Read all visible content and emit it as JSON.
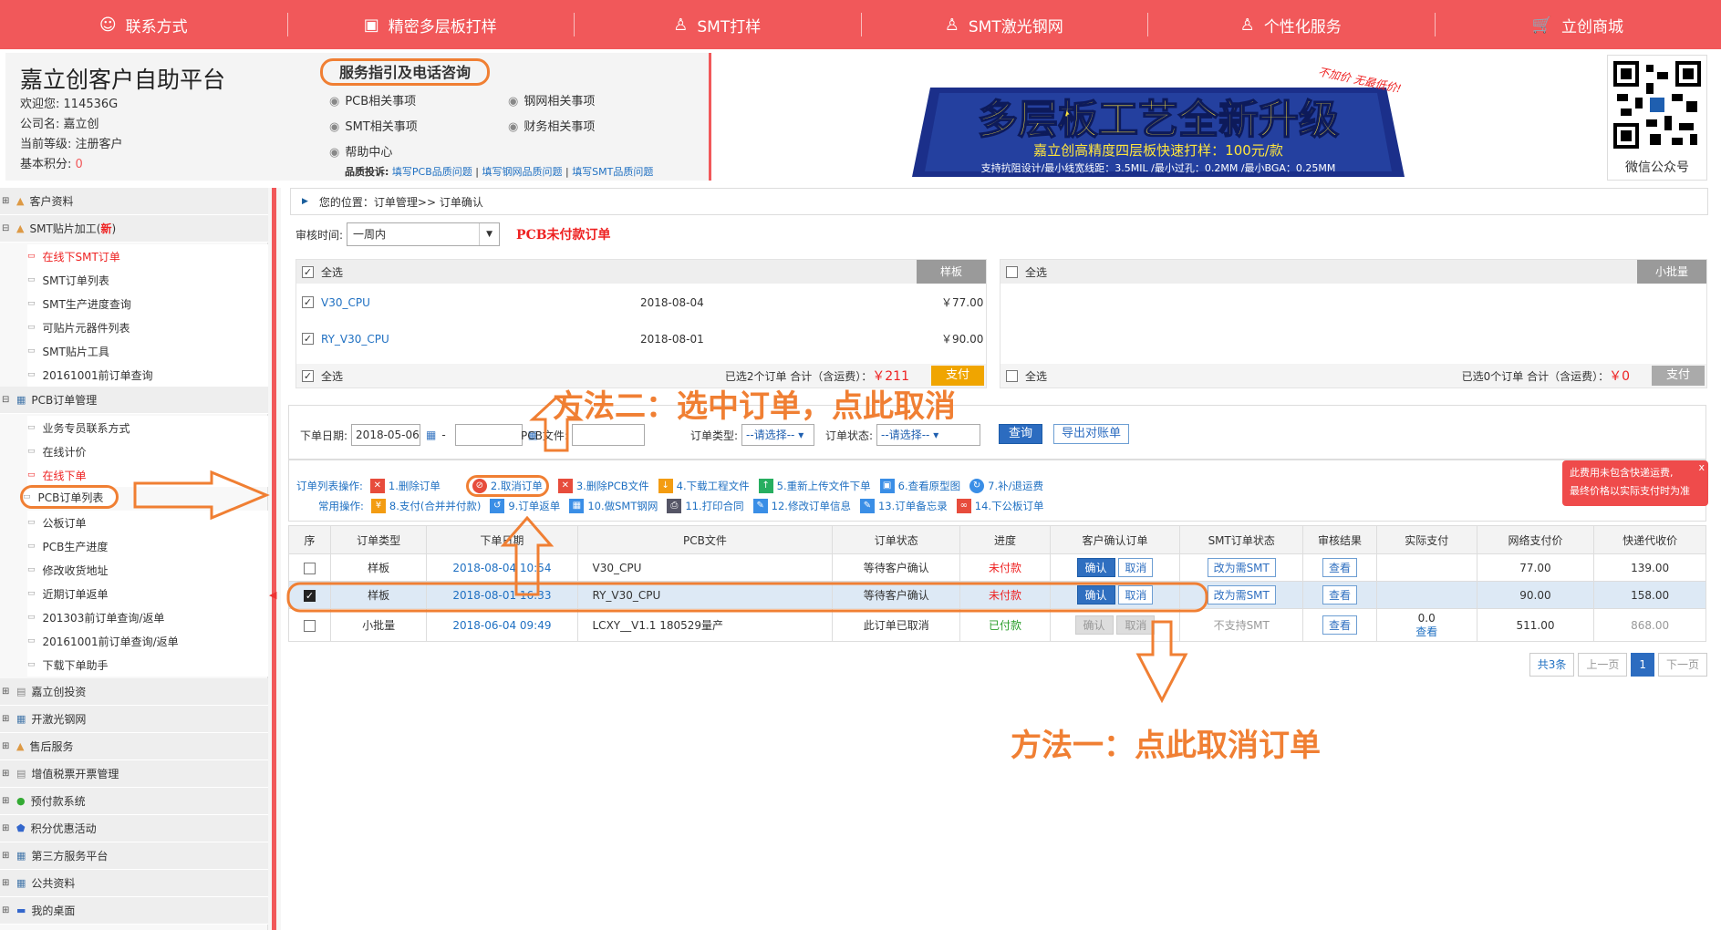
{
  "topnav": [
    {
      "icon": "person-icon",
      "glyph": "☺",
      "label": "联系方式"
    },
    {
      "icon": "chip-icon",
      "glyph": "▣",
      "label": "精密多层板打样"
    },
    {
      "icon": "person-icon",
      "glyph": "♙",
      "label": "SMT打样"
    },
    {
      "icon": "person-icon",
      "glyph": "♙",
      "label": "SMT激光钢网"
    },
    {
      "icon": "person-icon",
      "glyph": "♙",
      "label": "个性化服务"
    },
    {
      "icon": "cart-icon",
      "glyph": "🛒",
      "label": "立创商城"
    }
  ],
  "header": {
    "platform_title": "嘉立创客户自助平台",
    "welcome_label": "欢迎您:",
    "welcome_value": "114536G",
    "company_label": "公司名:",
    "company_value": "嘉立创",
    "level_label": "当前等级:",
    "level_value": "注册客户",
    "points_label": "基本积分:",
    "points_value": "0",
    "service_title": "服务指引及电话咨询",
    "links": [
      "PCB相关事项",
      "钢网相关事项",
      "SMT相关事项",
      "财务相关事项",
      "帮助中心"
    ],
    "quality_label": "品质投诉:",
    "quality_links": [
      "填写PCB品质问题",
      "填写钢网品质问题",
      "填写SMT品质问题"
    ],
    "banner_title": "多层板工艺全新升级",
    "banner_sub": "嘉立创高精度四层板快速打样：100元/款",
    "banner_note": "支持抗阻设计/最小线宽线距：3.5MIL  /最小过孔：0.2MM  /最小BGA：0.25MM",
    "banner_slogan": "不加价 无最低价!",
    "qr_label": "微信公众号"
  },
  "sidebar": {
    "groups": [
      {
        "label": "客户资料",
        "icon": "user-icon",
        "pm": "⊞"
      },
      {
        "label": "SMT贴片加工(",
        "badge": "新",
        "suffix": ")",
        "icon": "user-icon",
        "pm": "⊟"
      },
      {
        "label": "PCB订单管理",
        "icon": "grid-icon",
        "pm": "⊟"
      },
      {
        "label": "嘉立创投资",
        "icon": "doc-icon",
        "pm": "⊞"
      },
      {
        "label": "开激光钢网",
        "icon": "grid-icon",
        "pm": "⊞"
      },
      {
        "label": "售后服务",
        "icon": "user-icon",
        "pm": "⊞"
      },
      {
        "label": "增值税票开票管理",
        "icon": "doc-icon",
        "pm": "⊞"
      },
      {
        "label": "预付款系统",
        "icon": "coin-icon",
        "pm": "⊞"
      },
      {
        "label": "积分优惠活动",
        "icon": "shield-icon",
        "pm": "⊞"
      },
      {
        "label": "第三方服务平台",
        "icon": "grid-icon",
        "pm": "⊞"
      },
      {
        "label": "公共资料",
        "icon": "grid-icon",
        "pm": "⊞"
      },
      {
        "label": "我的桌面",
        "icon": "monitor-icon",
        "pm": "⊞"
      }
    ],
    "smt_items": [
      "在线下SMT订单",
      "SMT订单列表",
      "SMT生产进度查询",
      "可贴片元器件列表",
      "SMT贴片工具",
      "20161001前订单查询"
    ],
    "pcb_items": [
      "业务专员联系方式",
      "在线计价",
      "在线下单",
      "PCB订单列表",
      "公板订单",
      "PCB生产进度",
      "修改收货地址",
      "近期订单返单",
      "201303前订单查询/返单",
      "20161001前订单查询/返单",
      "下载下单助手"
    ]
  },
  "main": {
    "breadcrumb": "您的位置：订单管理>> 订单确认",
    "audit_label": "审核时间:",
    "audit_value": "一周内",
    "unpaid_title": "PCB未付款订单",
    "left_panel": {
      "select_all": "全选",
      "tag": "样板",
      "rows": [
        {
          "name": "V30_CPU",
          "date": "2018-08-04",
          "price": "￥77.00"
        },
        {
          "name": "RY_V30_CPU",
          "date": "2018-08-01",
          "price": "￥90.00"
        }
      ],
      "summary_prefix": "已选2个订单  合计（含运费）：",
      "summary_price": "￥211",
      "pay": "支付"
    },
    "right_panel": {
      "select_all": "全选",
      "tag": "小批量",
      "summary_prefix": "已选0个订单  合计（含运费）：",
      "summary_price": "￥0",
      "pay": "支付"
    },
    "filter": {
      "date_label": "下单日期:",
      "date_from": "2018-05-06",
      "date_sep": "-",
      "date_to": "",
      "pcb_label": "PCB文件:",
      "pcb_value": "",
      "type_label": "订单类型:",
      "type_value": "--请选择--",
      "status_label": "订单状态:",
      "status_value": "--请选择--",
      "query": "查询",
      "export": "导出对账单"
    },
    "ops": {
      "label1": "订单列表操作:",
      "line1": [
        "1.删除订单",
        "2.取消订单",
        "3.删除PCB文件",
        "4.下载工程文件",
        "5.重新上传文件下单",
        "6.查看原型图",
        "7.补/退运费"
      ],
      "label2": "常用操作:",
      "line2": [
        "8.支付(合并并付款)",
        "9.订单返单",
        "10.做SMT钢网",
        "11.打印合同",
        "12.修改订单信息",
        "13.订单备忘录",
        "14.下公板订单"
      ]
    },
    "notice": {
      "text1": "此费用未包含快递运费,",
      "text2": "最终价格以实际支付时为准",
      "close": "x"
    },
    "table": {
      "headers": [
        "序",
        "订单类型",
        "下单日期",
        "PCB文件",
        "订单状态",
        "进度",
        "客户确认订单",
        "SMT订单状态",
        "审核结果",
        "实际支付",
        "网络支付价",
        "快递代收价"
      ],
      "rows": [
        {
          "type": "样板",
          "date": "2018-08-04 10:54",
          "file": "V30_CPU",
          "status": "等待客户确认",
          "progress": "未付款",
          "confirm": "确认",
          "cancel": "取消",
          "smt": "改为需SMT",
          "audit": "查看",
          "paid": "",
          "paid_link": "",
          "net": "77.00",
          "cod": "139.00",
          "checked": false
        },
        {
          "type": "样板",
          "date": "2018-08-01 16:33",
          "file": "RY_V30_CPU",
          "status": "等待客户确认",
          "progress": "未付款",
          "confirm": "确认",
          "cancel": "取消",
          "smt": "改为需SMT",
          "audit": "查看",
          "paid": "",
          "paid_link": "",
          "net": "90.00",
          "cod": "158.00",
          "checked": true
        },
        {
          "type": "小批量",
          "date": "2018-06-04 09:49",
          "file": "LCXY__V1.1 180529量产",
          "status": "此订单已取消",
          "progress": "已付款",
          "confirm": "确认",
          "cancel": "取消",
          "smt": "不支持SMT",
          "audit": "查看",
          "paid": "0.0",
          "paid_link": "查看",
          "net": "511.00",
          "cod": "868.00",
          "checked": false
        }
      ]
    },
    "pager": {
      "total": "共3条",
      "prev": "上一页",
      "page": "1",
      "next": "下一页"
    }
  },
  "annotations": {
    "method2": "方法二：选中订单，点此取消",
    "method1": "方法一：点此取消订单"
  },
  "colors": {
    "brand": "#f1585a",
    "annotation": "#f07f33",
    "link": "#1f70c2"
  }
}
